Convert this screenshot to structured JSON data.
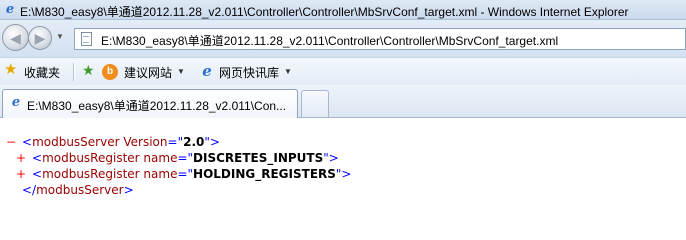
{
  "window": {
    "title": "E:\\M830_easy8\\单通道2012.11.28_v2.011\\Controller\\Controller\\MbSrvConf_target.xml - Windows Internet Explorer"
  },
  "navigation": {
    "address": "E:\\M830_easy8\\单通道2012.11.28_v2.011\\Controller\\Controller\\MbSrvConf_target.xml"
  },
  "favorites_bar": {
    "favorites_label": "收藏夹",
    "suggested_sites_label": "建议网站",
    "web_slice_gallery_label": "网页快讯库"
  },
  "tabs": [
    {
      "label": "E:\\M830_easy8\\单通道2012.11.28_v2.011\\Con..."
    }
  ],
  "xml": {
    "root": {
      "toggle": "−",
      "open_bracket": "<",
      "tag": "modbusServer",
      "attr_name": "Version",
      "attr_value": "2.0",
      "close_bracket": ">"
    },
    "children": [
      {
        "toggle": "+",
        "tag": "modbusRegister",
        "attr_name": "name",
        "attr_value": "DISCRETES_INPUTS"
      },
      {
        "toggle": "+",
        "tag": "modbusRegister",
        "attr_name": "name",
        "attr_value": "HOLDING_REGISTERS"
      }
    ],
    "closing_tag": "modbusServer"
  },
  "colors": {
    "bracket": "#0000ff",
    "tag": "#990000",
    "toggle": "#ff0000"
  }
}
